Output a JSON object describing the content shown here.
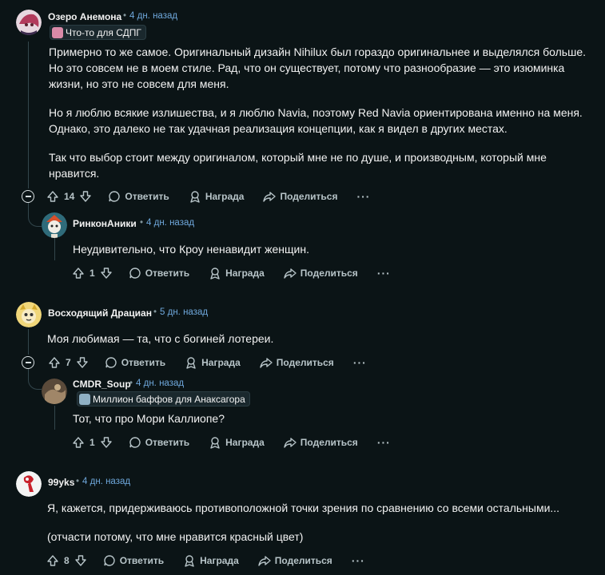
{
  "comments": [
    {
      "username": "Озеро Анемона",
      "time": "4 дн. назад",
      "flair": "Что-то для СДПГ",
      "paragraphs": [
        "Примерно то же самое. Оригинальный дизайн Nihilux был гораздо оригинальнее и выделялся больше. Но это совсем не в моем стиле. Рад, что он существует, потому что разнообразие — это изюминка жизни, но это не совсем для меня.",
        "Но я люблю всякие излишества, и я люблю Navia, поэтому Red Navia ориентирована именно на меня. Однако, это далеко не так удачная реализация концепции, как я видел в других местах.",
        "Так что выбор стоит между оригиналом, который мне не по душе, и производным, который мне нравится."
      ],
      "votes": "14"
    },
    {
      "username": "РинконАники",
      "time": "4 дн. назад",
      "paragraphs": [
        "Неудивительно, что Кроу ненавидит женщин."
      ],
      "votes": "1"
    },
    {
      "username": "Восходящий Драциан",
      "time": "5 дн. назад",
      "paragraphs": [
        "Моя любимая — та, что с богиней лотереи."
      ],
      "votes": "7"
    },
    {
      "username": "CMDR_Soup",
      "time": "4 дн. назад",
      "flair": "Миллион баффов для Анаксагора",
      "paragraphs": [
        "Тот, что про Мори Каллиопе?"
      ],
      "votes": "1"
    },
    {
      "username": "99yks",
      "time": "4 дн. назад",
      "paragraphs": [
        "Я, кажется, придерживаюсь противоположной точки зрения по сравнению со всеми остальными...",
        "(отчасти потому, что мне нравится красный цвет)"
      ],
      "votes": "8"
    }
  ],
  "labels": {
    "reply": "Ответить",
    "award": "Награда",
    "share": "Поделиться",
    "more": "···",
    "dot": "•"
  },
  "icons": [
    "upvote-icon",
    "downvote-icon",
    "reply-bubble-icon",
    "award-icon",
    "share-icon",
    "collapse-icon"
  ]
}
